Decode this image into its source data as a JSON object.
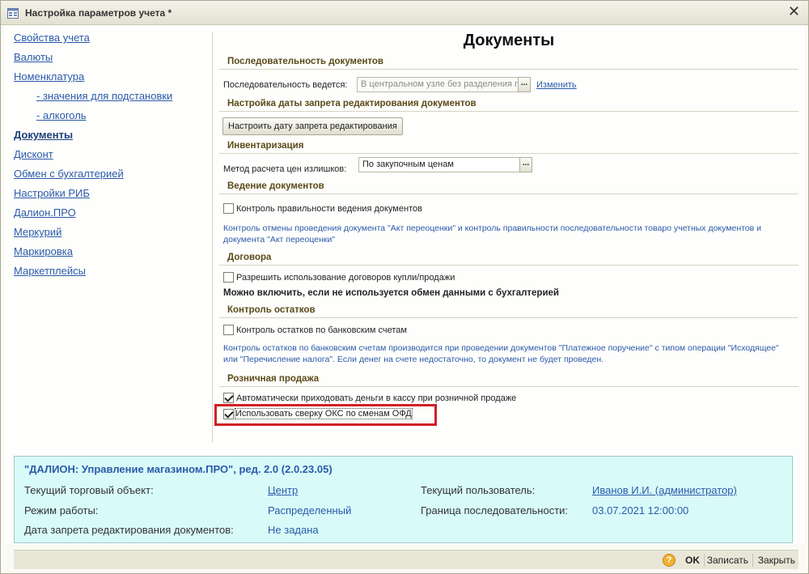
{
  "window": {
    "title": "Настройка параметров учета *",
    "close": "✕"
  },
  "nav": {
    "items": [
      "Свойства учета",
      "Валюты",
      "Номенклатура",
      "- значения для подстановки",
      "- алкоголь",
      "Документы",
      "Дисконт",
      "Обмен с бухгалтерией",
      "Настройки РИБ",
      "Далион.ПРО",
      "Меркурий",
      "Маркировка",
      "Маркетплейсы"
    ],
    "active": "Документы"
  },
  "page": {
    "title": "Документы"
  },
  "sections": {
    "sequence": {
      "header": "Последовательность документов",
      "label": "Последовательность ведется:",
      "value": "В центральном узле без разделения г",
      "change_link": "Изменить"
    },
    "edit_date": {
      "header": "Настройка даты запрета редактирования документов",
      "button": "Настроить дату запрета редактирования"
    },
    "inventory": {
      "header": "Инвентаризация",
      "label": "Метод расчета цен излишков:",
      "value": "По закупочным ценам"
    },
    "doc_keeping": {
      "header": "Ведение документов",
      "checkbox": "Контроль правильности ведения документов",
      "checked": false,
      "hint": "Контроль отмены проведения документа \"Акт переоценки\" и контроль правильности последовательности товаро учетных документов и документа \"Акт переоценки\""
    },
    "contracts": {
      "header": "Договора",
      "checkbox": "Разрешить использование договоров купли/продажи",
      "checked": false,
      "note": "Можно включить, если не используется обмен данными с бухгалтерией"
    },
    "balance": {
      "header": "Контроль остатков",
      "checkbox": "Контроль остатков по банковским счетам",
      "checked": false,
      "hint": "Контроль остатков по банковским счетам производится при проведении документов \"Платежное поручение\" с типом операции \"Исходящее\" или \"Перечисление налога\". Если денег на счете недостаточно, то документ не будет проведен."
    },
    "retail": {
      "header": "Розничная продажа",
      "checkbox1": "Автоматически приходовать деньги в кассу при розничной продаже",
      "checked1": true,
      "checkbox2": "Использовать сверку ОКС по сменам ОФД",
      "checked2": true
    }
  },
  "info": {
    "product": "\"ДАЛИОН: Управление магазином.ПРО\", ред. 2.0 (2.0.23.05)",
    "store_label": "Текущий торговый объект:",
    "store_value": "Центр",
    "mode_label": "Режим работы:",
    "mode_value": "Распределенный",
    "lockdate_label": "Дата запрета редактирования документов:",
    "lockdate_value": "Не задана",
    "user_label": "Текущий пользователь:",
    "user_value": "Иванов И.И. (администратор)",
    "seq_label": "Граница последовательности:",
    "seq_value": "03.07.2021 12:00:00"
  },
  "statusbar": {
    "help": "?",
    "ok": "OK",
    "save": "Записать",
    "close": "Закрыть"
  },
  "colors": {
    "highlight": "#d21f25",
    "info_bg": "#d8fbfa",
    "link": "#2b5aa8"
  }
}
